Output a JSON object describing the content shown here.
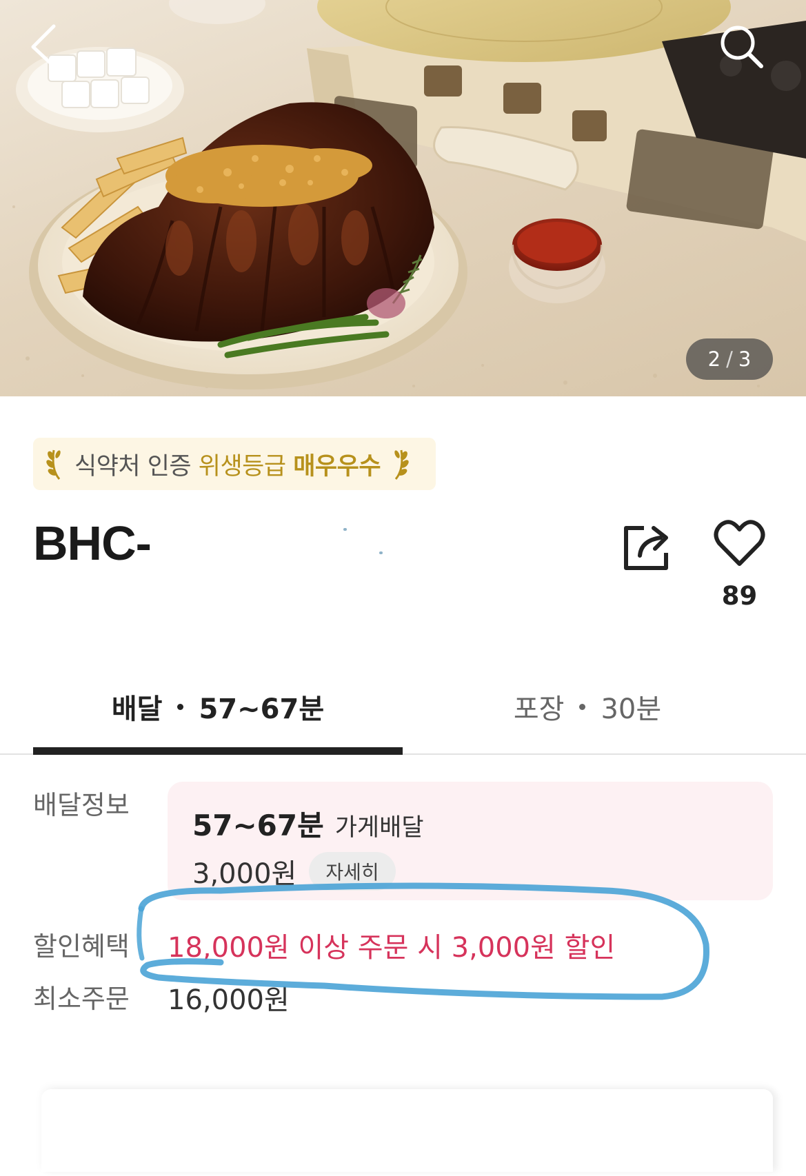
{
  "gallery": {
    "current": "2",
    "total": "3",
    "separator": "/"
  },
  "hygiene_badge": {
    "part1": "식약처 인증",
    "part2": "위생등급",
    "part3": "매우우수"
  },
  "store": {
    "name_visible": "BHC-",
    "like_count": "89"
  },
  "tabs": [
    {
      "label": "배달",
      "time": "57~67분",
      "active": true
    },
    {
      "label": "포장",
      "time": "30분",
      "active": false
    }
  ],
  "delivery_info": {
    "label": "배달정보",
    "time": "57~67분",
    "type": "가게배달",
    "fee": "3,000원",
    "detail_button": "자세히"
  },
  "discount": {
    "label": "할인혜택",
    "text": "18,000원 이상 주문 시 3,000원 할인"
  },
  "min_order": {
    "label": "최소주문",
    "value": "16,000원"
  },
  "colors": {
    "discount_text": "#d6335b",
    "badge_gold": "#b7911c",
    "badge_bg": "#fdf6e4",
    "delivery_box_bg": "#fdf1f3",
    "annotation_blue": "#4aa3d6"
  }
}
